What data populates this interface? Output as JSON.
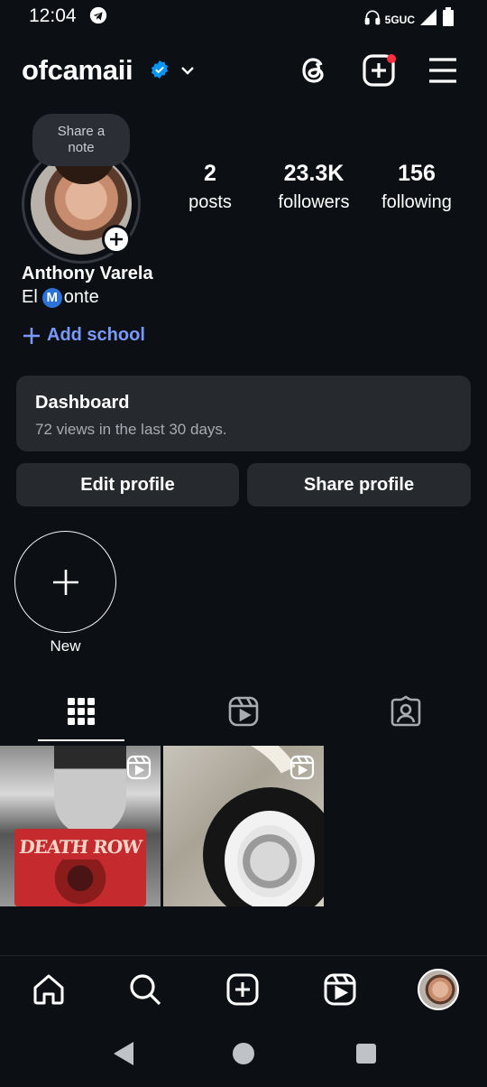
{
  "status_bar": {
    "time": "12:04",
    "network": "5GUC"
  },
  "header": {
    "username": "ofcamaii"
  },
  "profile": {
    "note_label": "Share a note",
    "stats": {
      "posts_count": "2",
      "posts_label": "posts",
      "followers_count": "23.3K",
      "followers_label": "followers",
      "following_count": "156",
      "following_label": "following"
    },
    "full_name": "Anthony Varela",
    "bio_prefix": "El",
    "bio_emoji": "M",
    "bio_suffix": "onte",
    "add_school_label": "Add school"
  },
  "dashboard": {
    "title": "Dashboard",
    "subtitle": "72 views in the last 30 days."
  },
  "buttons": {
    "edit_profile": "Edit profile",
    "share_profile": "Share profile"
  },
  "highlights": {
    "new_label": "New"
  },
  "posts": [
    {
      "shirt_text": "DEATH ROW",
      "type_icon": "reels-icon"
    },
    {
      "type_icon": "reels-icon"
    }
  ],
  "colors": {
    "background": "#0c1014",
    "card": "#26292e",
    "link_blue": "#7a98ff",
    "verified_blue": "#0095f6",
    "notification_red": "#ff3040"
  },
  "icons": {
    "header": [
      "threads-icon",
      "create-icon",
      "menu-icon"
    ],
    "tabs": [
      "grid-icon",
      "reels-icon",
      "tagged-icon"
    ],
    "bottom_nav": [
      "home-icon",
      "search-icon",
      "create-icon",
      "reels-icon",
      "profile-avatar"
    ]
  }
}
